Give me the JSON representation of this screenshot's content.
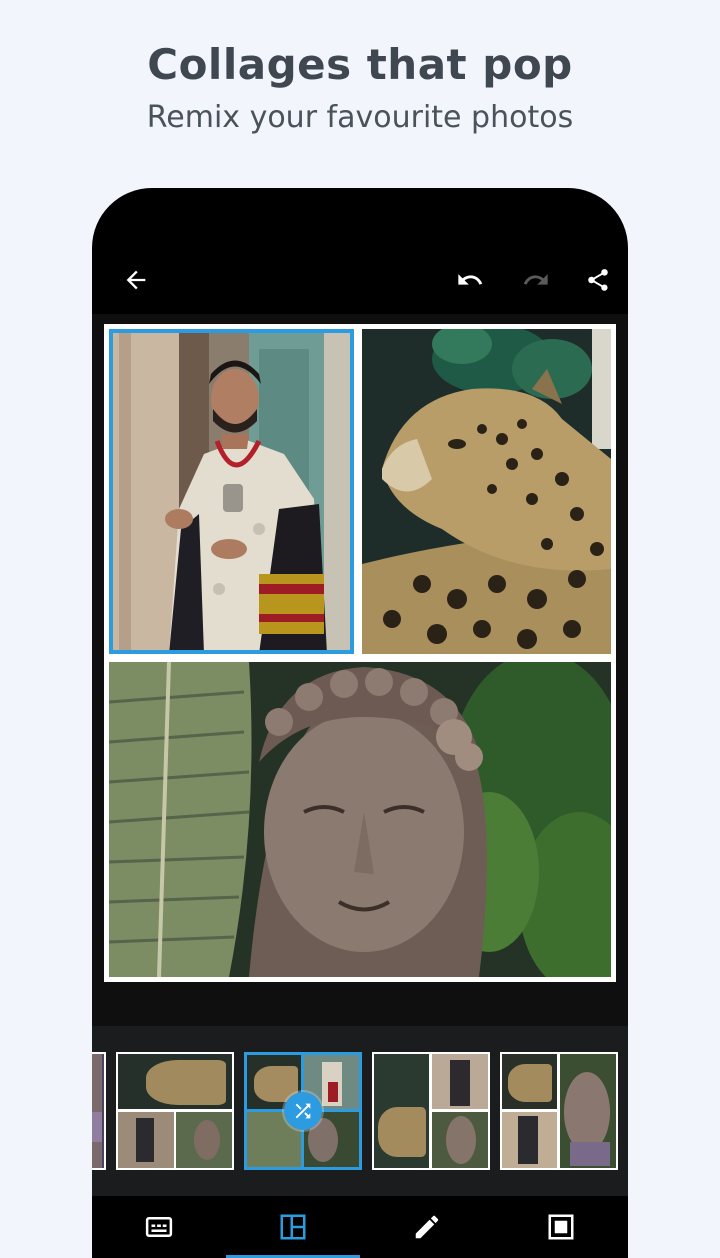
{
  "promo": {
    "title": "Collages that pop",
    "subtitle": "Remix your favourite photos"
  },
  "appbar": {
    "back_icon": "back-arrow-icon",
    "undo_icon": "undo-icon",
    "redo_icon": "redo-icon",
    "share_icon": "share-icon",
    "redo_enabled": false
  },
  "collage": {
    "cells": [
      {
        "photo": "man-in-traditional-attire",
        "selected": true
      },
      {
        "photo": "leopard",
        "selected": false
      },
      {
        "photo": "buddha-statue-with-leaves",
        "selected": false
      }
    ]
  },
  "layouts": {
    "selected_index": 2,
    "shuffle_icon": "shuffle-icon"
  },
  "tabs": [
    {
      "icon": "text-box-icon",
      "active": false
    },
    {
      "icon": "layout-icon",
      "active": true
    },
    {
      "icon": "pencil-icon",
      "active": false
    },
    {
      "icon": "border-frame-icon",
      "active": false
    }
  ],
  "colors": {
    "accent": "#2d9be0",
    "background": "#f2f6fc",
    "phone": "#000000"
  }
}
